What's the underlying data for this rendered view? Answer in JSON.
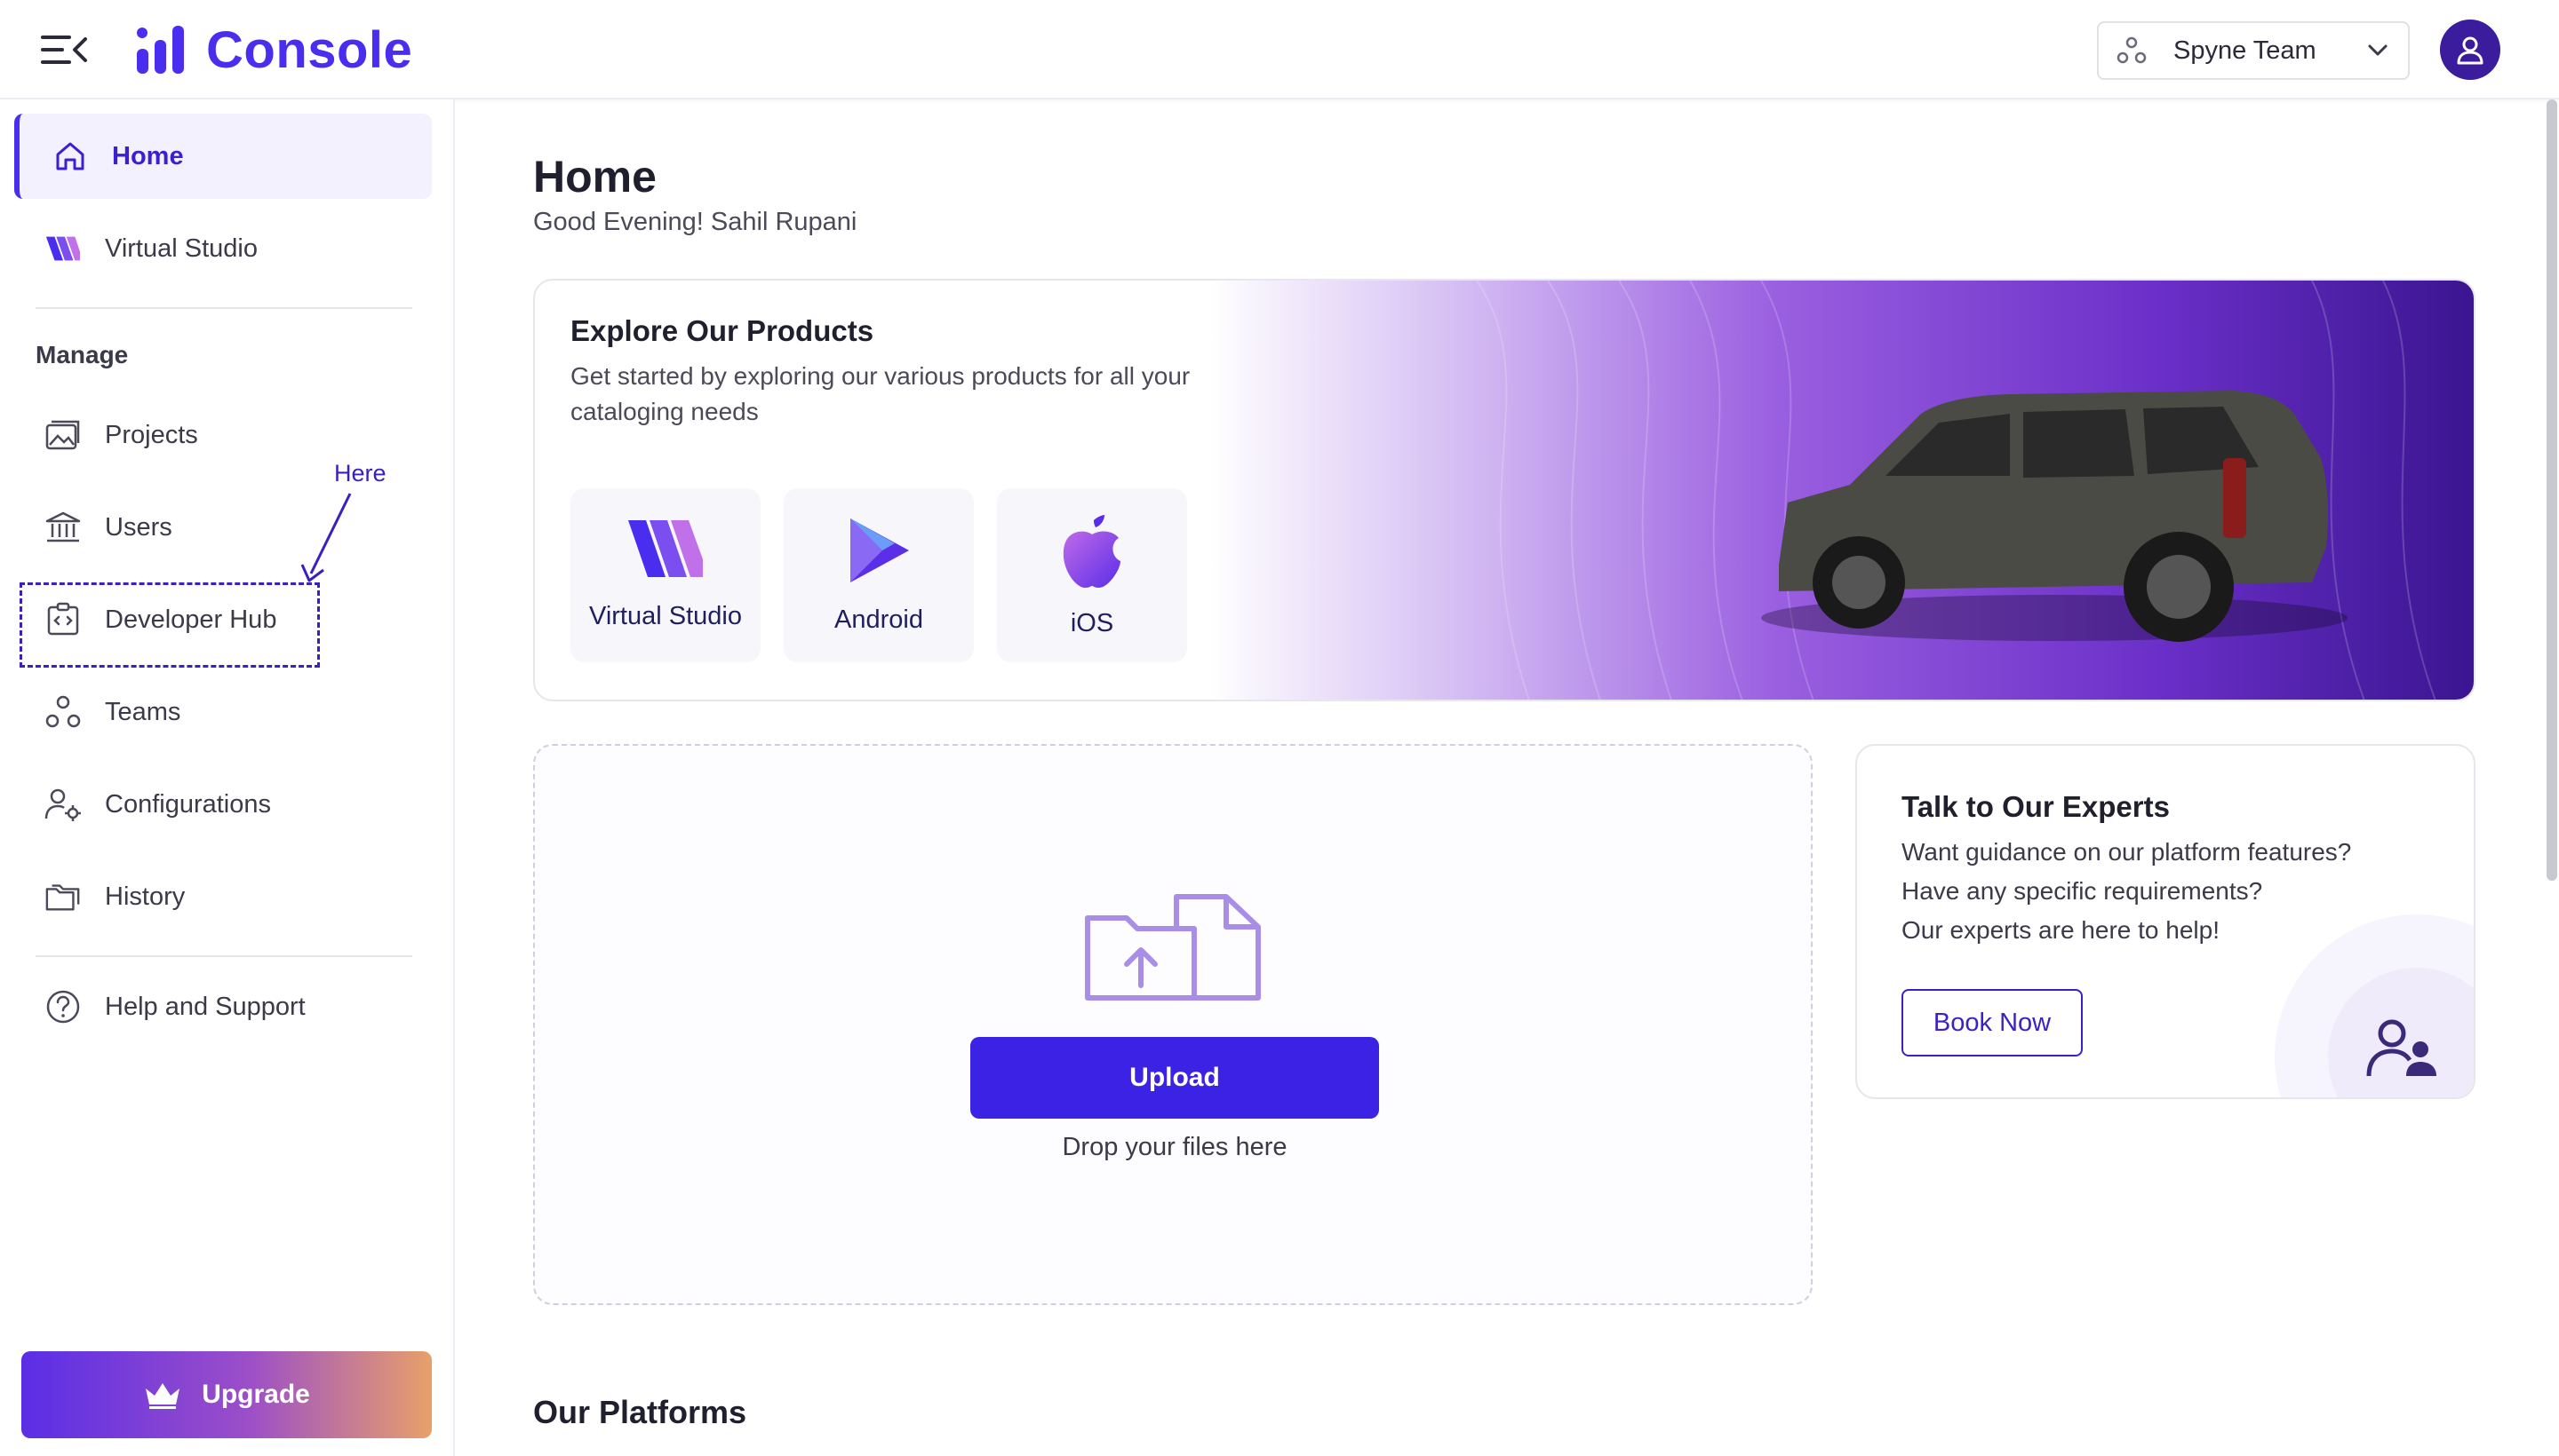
{
  "header": {
    "logo_text": "Console",
    "team_name": "Spyne Team"
  },
  "sidebar": {
    "items": [
      {
        "label": "Home"
      },
      {
        "label": "Virtual Studio"
      }
    ],
    "section_title": "Manage",
    "manage_items": [
      {
        "label": "Projects"
      },
      {
        "label": "Users"
      },
      {
        "label": "Developer Hub"
      },
      {
        "label": "Teams"
      },
      {
        "label": "Configurations"
      },
      {
        "label": "History"
      }
    ],
    "help_label": "Help and Support",
    "annotation_label": "Here",
    "upgrade_label": "Upgrade"
  },
  "main": {
    "title": "Home",
    "greeting": "Good Evening! Sahil Rupani",
    "explore": {
      "title": "Explore Our Products",
      "description": "Get started by exploring our various products for all your cataloging needs",
      "products": [
        {
          "label": "Virtual Studio",
          "icon": "virtual-studio-icon"
        },
        {
          "label": "Android",
          "icon": "android-play-icon"
        },
        {
          "label": "iOS",
          "icon": "apple-icon"
        }
      ]
    },
    "upload": {
      "button_label": "Upload",
      "drop_text": "Drop your files here"
    },
    "experts": {
      "title": "Talk to Our Experts",
      "lines": [
        "Want guidance on our platform features?",
        "Have any specific requirements?",
        "Our experts are here to help!"
      ],
      "button_label": "Book Now"
    },
    "platforms_title": "Our Platforms"
  },
  "colors": {
    "accent": "#4a2ef0",
    "active_bg": "#f3f1fe",
    "primary_button": "#3b22e4",
    "avatar_bg": "#3b1c9c"
  }
}
